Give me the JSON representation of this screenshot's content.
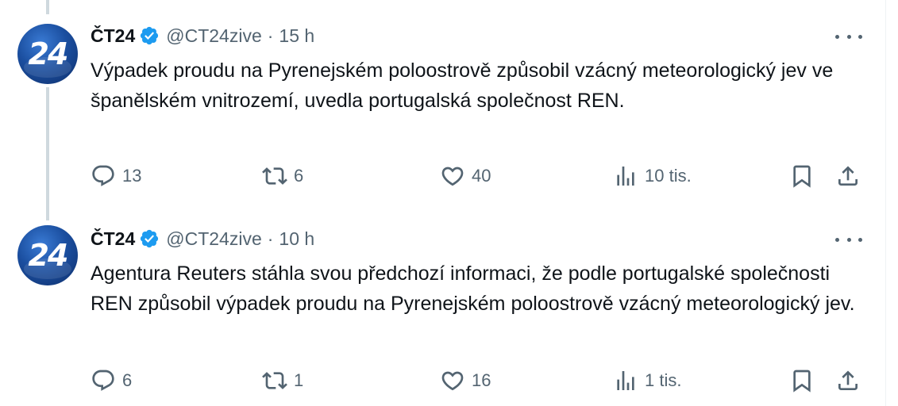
{
  "tweets": [
    {
      "avatar_text": "24",
      "name": "ČT24",
      "handle": "@CT24zive",
      "separator": "·",
      "time": "15 h",
      "text": "Výpadek proudu na Pyrenejském poloostrově způsobil vzácný meteorologický jev ve španělském vnitrozemí, uvedla portugalská společnost REN.",
      "replies": "13",
      "reposts": "6",
      "likes": "40",
      "views": "10 tis."
    },
    {
      "avatar_text": "24",
      "name": "ČT24",
      "handle": "@CT24zive",
      "separator": "·",
      "time": "10 h",
      "text": "Agentura Reuters stáhla svou předchozí informaci, že podle portugalské společnosti REN způsobil výpadek proudu na Pyrenejském poloostrově vzácný meteorologický jev.",
      "replies": "6",
      "reposts": "1",
      "likes": "16",
      "views": "1 tis."
    }
  ],
  "icons": {
    "verified": "verified-badge-icon",
    "more": "more-icon",
    "reply": "reply-icon",
    "repost": "repost-icon",
    "like": "heart-icon",
    "views": "views-icon",
    "bookmark": "bookmark-icon",
    "share": "share-icon"
  },
  "colors": {
    "verified": "#1d9bf0",
    "text": "#0f1419",
    "muted": "#536471",
    "thread_line": "#cfd9de"
  }
}
